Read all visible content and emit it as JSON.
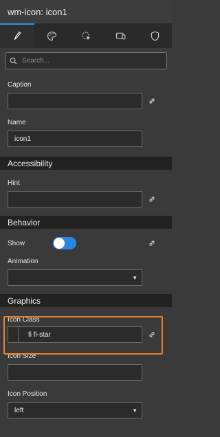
{
  "title": "wm-icon: icon1",
  "tabs": [
    {
      "icon": "pencil-icon",
      "active": true
    },
    {
      "icon": "palette-icon"
    },
    {
      "icon": "cursor-click-icon"
    },
    {
      "icon": "devices-icon"
    },
    {
      "icon": "shield-icon"
    }
  ],
  "search": {
    "placeholder": "Search..."
  },
  "fields": {
    "caption": {
      "label": "Caption",
      "value": ""
    },
    "name": {
      "label": "Name",
      "value": "icon1"
    },
    "hint": {
      "label": "Hint",
      "value": ""
    },
    "show": {
      "label": "Show",
      "on": true
    },
    "animation": {
      "label": "Animation",
      "value": ""
    },
    "icon_class": {
      "label": "Icon Class",
      "value": "fi fi-star"
    },
    "icon_size": {
      "label": "Icon Size",
      "value": ""
    },
    "icon_position": {
      "label": "Icon Position",
      "value": "left"
    }
  },
  "sections": {
    "accessibility": "Accessibility",
    "behavior": "Behavior",
    "graphics": "Graphics"
  },
  "colors": {
    "accent": "#2196f3",
    "highlight": "#e8822e"
  }
}
